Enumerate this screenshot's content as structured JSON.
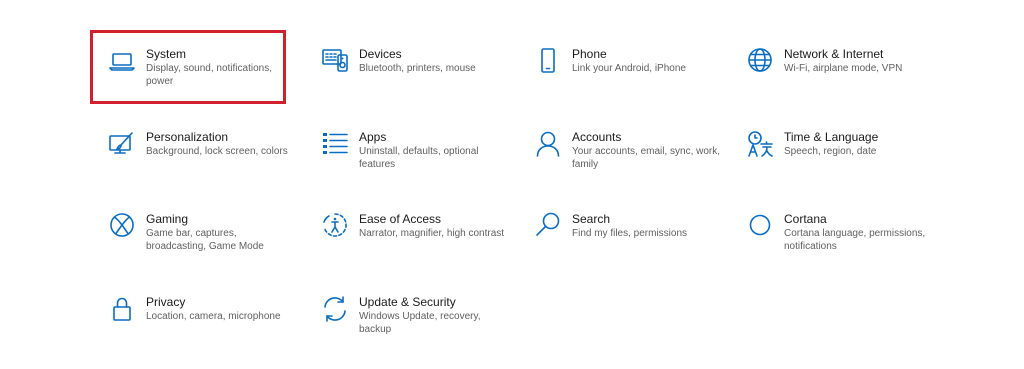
{
  "accent_color": "#0a6dc2",
  "selection_color": "#d0202d",
  "tiles": [
    {
      "title": "System",
      "desc": "Display, sound, notifications, power",
      "icon": "laptop-icon"
    },
    {
      "title": "Devices",
      "desc": "Bluetooth, printers, mouse",
      "icon": "devices-icon"
    },
    {
      "title": "Phone",
      "desc": "Link your Android, iPhone",
      "icon": "phone-icon"
    },
    {
      "title": "Network & Internet",
      "desc": "Wi-Fi, airplane mode, VPN",
      "icon": "globe-icon"
    },
    {
      "title": "Personalization",
      "desc": "Background, lock screen, colors",
      "icon": "personalization-icon"
    },
    {
      "title": "Apps",
      "desc": "Uninstall, defaults, optional features",
      "icon": "apps-list-icon"
    },
    {
      "title": "Accounts",
      "desc": "Your accounts, email, sync, work, family",
      "icon": "person-icon"
    },
    {
      "title": "Time & Language",
      "desc": "Speech, region, date",
      "icon": "time-language-icon"
    },
    {
      "title": "Gaming",
      "desc": "Game bar, captures, broadcasting, Game Mode",
      "icon": "xbox-icon"
    },
    {
      "title": "Ease of Access",
      "desc": "Narrator, magnifier, high contrast",
      "icon": "ease-of-access-icon"
    },
    {
      "title": "Search",
      "desc": "Find my files, permissions",
      "icon": "search-icon"
    },
    {
      "title": "Cortana",
      "desc": "Cortana language, permissions, notifications",
      "icon": "cortana-icon"
    },
    {
      "title": "Privacy",
      "desc": "Location, camera, microphone",
      "icon": "lock-icon"
    },
    {
      "title": "Update & Security",
      "desc": "Windows Update, recovery, backup",
      "icon": "sync-icon"
    }
  ]
}
